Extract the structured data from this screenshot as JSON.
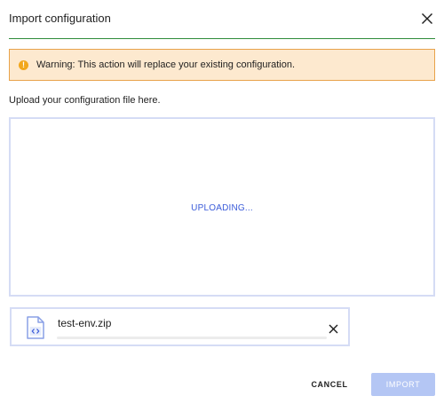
{
  "dialog": {
    "title": "Import configuration",
    "close_icon": "close-icon"
  },
  "warning": {
    "icon": "warning-icon",
    "icon_glyph": "!",
    "text": "Warning: This action will replace your existing configuration."
  },
  "upload": {
    "instructions": "Upload your configuration file here.",
    "status": "UPLOADING..."
  },
  "file": {
    "icon": "code-file-icon",
    "name": "test-env.zip",
    "progress_fraction": 0.0,
    "remove_icon": "close-icon"
  },
  "footer": {
    "cancel_label": "CANCEL",
    "import_label": "IMPORT",
    "import_enabled": false
  },
  "colors": {
    "header_rule": "#2e8b3a",
    "warning_bg": "#fde9cf",
    "warning_border": "#e8a24a",
    "warning_icon": "#f2a71c",
    "accent": "#3a5bd9",
    "dropzone_border": "#d5dcf5",
    "import_disabled_bg": "#b4c6f4"
  }
}
